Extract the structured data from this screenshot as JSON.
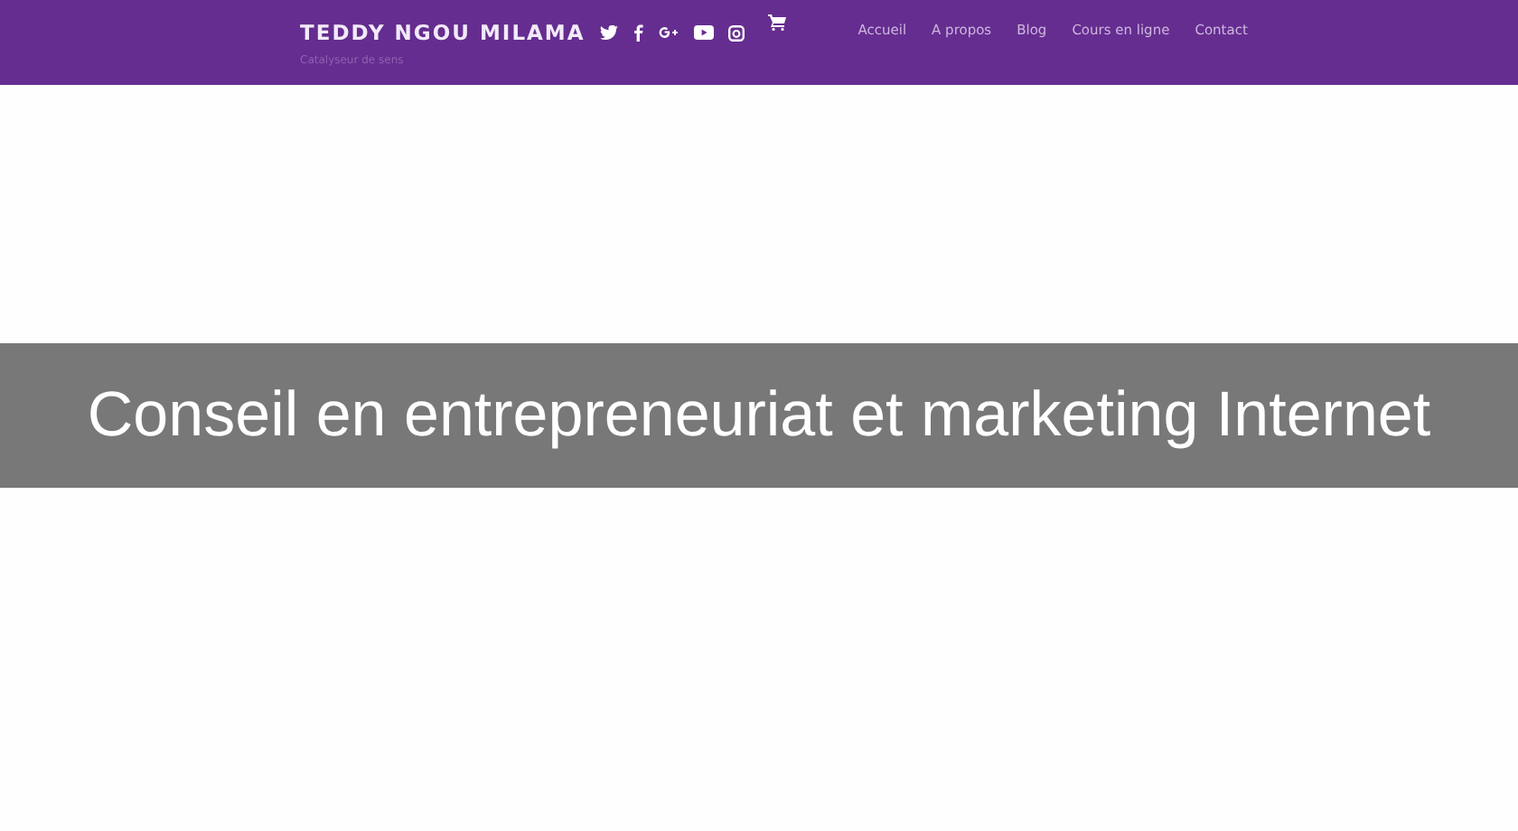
{
  "header": {
    "site_title": "TEDDY NGOU MILAMA",
    "tagline": "Catalyseur de sens",
    "social_icons": [
      {
        "kind": "twitter"
      },
      {
        "kind": "facebook"
      },
      {
        "kind": "googleplus"
      },
      {
        "kind": "youtube"
      },
      {
        "kind": "instagram"
      }
    ],
    "nav": [
      "Accueil",
      "A propos",
      "Blog",
      "Cours en ligne",
      "Contact"
    ]
  },
  "banner": {
    "title": "Conseil en entrepreneuriat et marketing Internet"
  }
}
